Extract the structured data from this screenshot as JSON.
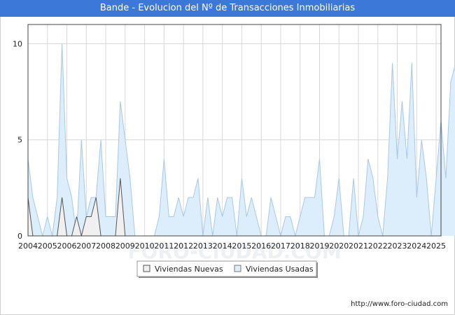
{
  "title": "Bande - Evolucion del Nº de Transacciones Inmobiliarias",
  "footer_url": "http://www.foro-ciudad.com",
  "watermark": "FORO-CIUDAD.COM",
  "colors": {
    "title_bg": "#3b78d8",
    "usadas_fill": "#dceefc",
    "usadas_line": "#a8c8e8",
    "nuevas_fill": "#f0f0f0",
    "nuevas_line": "#555555",
    "grid": "#d8d8d8"
  },
  "chart_data": {
    "type": "area",
    "title": "Bande - Evolucion del Nº de Transacciones Inmobiliarias",
    "xlabel": "",
    "ylabel": "",
    "x_start": 2004,
    "points_per_year": 4,
    "xlim": [
      2004,
      2025.25
    ],
    "ylim": [
      0,
      11
    ],
    "yticks": [
      0,
      5,
      10
    ],
    "xticks": [
      "2004",
      "2005",
      "2006",
      "2007",
      "2008",
      "2009",
      "2010",
      "2011",
      "2012",
      "2013",
      "2014",
      "2015",
      "2016",
      "2017",
      "2018",
      "2019",
      "2020",
      "2021",
      "2022",
      "2023",
      "2024",
      "2025"
    ],
    "grid": true,
    "legend_position": "bottom-center",
    "series": [
      {
        "name": "Viviendas Nuevas",
        "values": [
          2,
          0,
          0,
          0,
          0,
          0,
          0,
          2,
          0,
          0,
          1,
          0,
          1,
          1,
          2,
          0,
          0,
          0,
          0,
          3,
          0,
          0,
          0,
          0,
          0,
          0,
          0,
          0,
          0,
          0,
          0,
          0,
          0,
          0,
          0,
          0,
          0,
          0,
          0,
          0,
          0,
          0,
          0,
          0,
          0,
          0,
          0,
          0,
          0,
          0,
          0,
          0,
          0,
          0,
          0,
          0,
          0,
          0,
          0,
          0,
          0,
          0,
          0,
          0,
          0,
          0,
          0,
          0,
          0,
          0,
          0,
          0,
          0,
          0,
          0,
          0,
          0,
          0,
          0,
          0,
          0,
          0,
          0,
          0,
          0,
          0
        ]
      },
      {
        "name": "Viviendas Usadas",
        "values": [
          4,
          2,
          1,
          0,
          1,
          0,
          2,
          10,
          3,
          2,
          0,
          5,
          1,
          2,
          2,
          5,
          1,
          1,
          1,
          7,
          5,
          3,
          0,
          0,
          0,
          0,
          0,
          1,
          4,
          1,
          1,
          2,
          1,
          2,
          2,
          3,
          0,
          2,
          0,
          2,
          1,
          2,
          2,
          0,
          3,
          1,
          2,
          1,
          0,
          0,
          2,
          1,
          0,
          1,
          1,
          0,
          1,
          2,
          2,
          2,
          4,
          0,
          0,
          1,
          3,
          0,
          0,
          3,
          0,
          1,
          4,
          3,
          1,
          0,
          3,
          9,
          4,
          7,
          4,
          9,
          2,
          5,
          3,
          0,
          3,
          6,
          3,
          8,
          9
        ]
      }
    ]
  }
}
